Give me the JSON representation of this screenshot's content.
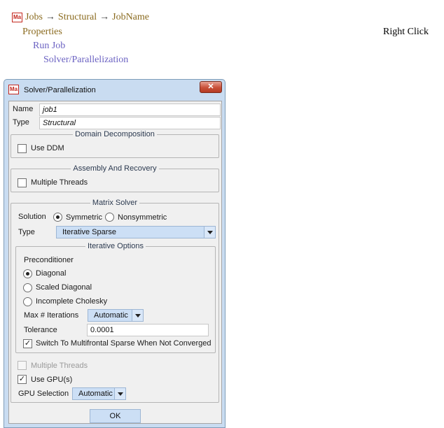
{
  "breadcrumb": {
    "items": [
      "Jobs",
      "Structural",
      "JobName"
    ],
    "separator": "→",
    "level2": "Properties",
    "level3": "Run Job",
    "level4": "Solver/Parallelization",
    "logo_text": "Ma"
  },
  "hint": "Right Click",
  "dialog": {
    "title": "Solver/Parallelization",
    "logo_text": "Ma",
    "close_label": "✕",
    "name_label": "Name",
    "name_value": "job1",
    "type_label": "Type",
    "type_value": "Structural",
    "domain_decomposition": {
      "title": "Domain Decomposition",
      "use_ddm_label": "Use DDM",
      "use_ddm_checked": false
    },
    "assembly_recovery": {
      "title": "Assembly And Recovery",
      "multiple_threads_label": "Multiple Threads",
      "multiple_threads_checked": false
    },
    "matrix_solver": {
      "title": "Matrix Solver",
      "solution_label": "Solution",
      "symmetric_label": "Symmetric",
      "nonsymmetric_label": "Nonsymmetric",
      "selected_solution": "Symmetric",
      "type_label": "Type",
      "type_value": "Iterative Sparse",
      "iterative_options": {
        "title": "Iterative Options",
        "preconditioner_label": "Preconditioner",
        "diagonal_label": "Diagonal",
        "scaled_diagonal_label": "Scaled Diagonal",
        "incomplete_cholesky_label": "Incomplete Cholesky",
        "selected_preconditioner": "Diagonal",
        "max_iterations_label": "Max # Iterations",
        "max_iterations_value": "Automatic",
        "tolerance_label": "Tolerance",
        "tolerance_value": "0.0001",
        "switch_label": "Switch To Multifrontal Sparse When Not Converged",
        "switch_checked": true,
        "check_glyph": "✓"
      },
      "multiple_threads_label": "Multiple Threads",
      "multiple_threads_checked": false,
      "use_gpu_label": "Use GPU(s)",
      "use_gpu_checked": true,
      "check_glyph": "✓",
      "gpu_selection_label": "GPU Selection",
      "gpu_selection_value": "Automatic"
    },
    "ok_label": "OK"
  },
  "colors": {
    "crumb_brown": "#8a6a1e",
    "crumb_purple": "#6b62c2",
    "dialog_frame": "#c9dcf1",
    "close_red": "#c9503a",
    "combo_blue": "#ccdff5"
  }
}
